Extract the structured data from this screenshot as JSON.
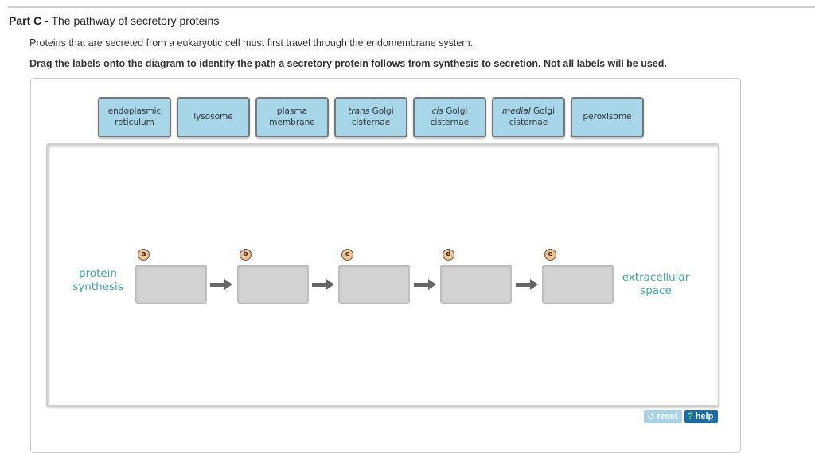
{
  "header": {
    "part_label": "Part C -",
    "part_title": "The pathway of secretory proteins",
    "intro": "Proteins that are secreted from a eukaryotic cell must first travel through the endomembrane system.",
    "instruction": "Drag the labels onto the diagram to identify the path a secretory protein follows from synthesis to secretion. Not all labels will be used."
  },
  "labels": [
    {
      "italic": "",
      "text": "endoplasmic reticulum"
    },
    {
      "italic": "",
      "text": "lysosome"
    },
    {
      "italic": "",
      "text": "plasma membrane"
    },
    {
      "italic": "trans",
      "text": "Golgi cisternae"
    },
    {
      "italic": "cis",
      "text": "Golgi cisternae"
    },
    {
      "italic": "medial",
      "text": "Golgi cisternae"
    },
    {
      "italic": "",
      "text": "peroxisome"
    }
  ],
  "diagram": {
    "start_label": "protein synthesis",
    "end_label": "extracellular space",
    "targets": [
      "a",
      "b",
      "c",
      "d",
      "e"
    ]
  },
  "controls": {
    "reset_label": "reset",
    "reset_icon": "refresh-icon",
    "help_label": "help",
    "help_icon": "question-icon"
  },
  "colors": {
    "label_bg": "#a6d6e8",
    "target_bg": "#d2d2d2",
    "badge_bg": "#f6c08a",
    "teal_text": "#3aa6a6",
    "help_bg": "#1b6ea4",
    "reset_bg": "#a7d3ea"
  }
}
